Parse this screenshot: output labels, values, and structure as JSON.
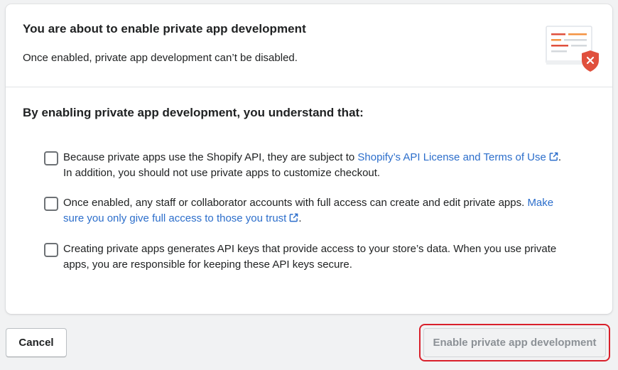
{
  "dialog": {
    "title": "You are about to enable private app development",
    "subtitle": "Once enabled, private app development can’t be disabled.",
    "illustration_icon": "document-warning-icon"
  },
  "section": {
    "title": "By enabling private app development, you understand that:"
  },
  "items": [
    {
      "checked": false,
      "text_before": "Because private apps use the Shopify API, they are subject to ",
      "link": "Shopify’s API License and Terms of Use",
      "text_after": ". In addition, you should not use private apps to customize checkout."
    },
    {
      "checked": false,
      "text_before": "Once enabled, any staff or collaborator accounts with full access can create and edit private apps. ",
      "link": "Make sure you only give full access to those you trust",
      "text_after": "."
    },
    {
      "checked": false,
      "text": "Creating private apps generates API keys that provide access to your store’s data. When you use private apps, you are responsible for keeping these API keys secure."
    }
  ],
  "footer": {
    "cancel_label": "Cancel",
    "enable_label": "Enable private app development",
    "enable_disabled": true
  },
  "colors": {
    "link": "#2c6ecb",
    "highlight": "#d9202b",
    "illustration_red": "#e0503d",
    "illustration_orange": "#f49342"
  }
}
